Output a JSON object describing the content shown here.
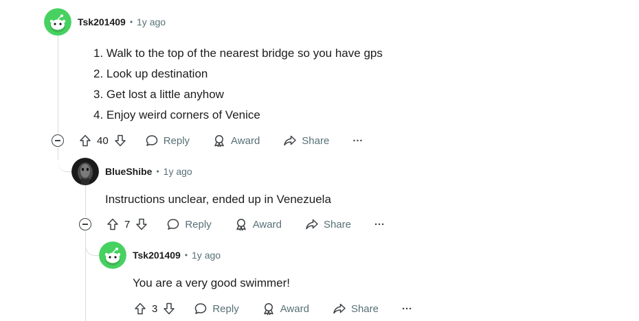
{
  "comments": [
    {
      "author": "Tsk201409",
      "separator": "•",
      "time": "1y ago",
      "lines": [
        "1. Walk to the top of the nearest bridge so you have gps",
        "2. Look up destination",
        "3. Get lost a little anyhow",
        "4. Enjoy weird corners of Venice"
      ],
      "votes": "40",
      "reply_label": "Reply",
      "award_label": "Award",
      "share_label": "Share",
      "more_label": "···"
    },
    {
      "author": "BlueShibe",
      "separator": "•",
      "time": "1y ago",
      "text": "Instructions unclear, ended up in Venezuela",
      "votes": "7",
      "reply_label": "Reply",
      "award_label": "Award",
      "share_label": "Share",
      "more_label": "···"
    },
    {
      "author": "Tsk201409",
      "separator": "•",
      "time": "1y ago",
      "text": "You are a very good swimmer!",
      "votes": "3",
      "reply_label": "Reply",
      "award_label": "Award",
      "share_label": "Share",
      "more_label": "···"
    }
  ],
  "colors": {
    "avatar_green": "#46d160",
    "text": "#1c1c1c",
    "muted": "#576f76",
    "thread_line": "#d7dadc"
  }
}
